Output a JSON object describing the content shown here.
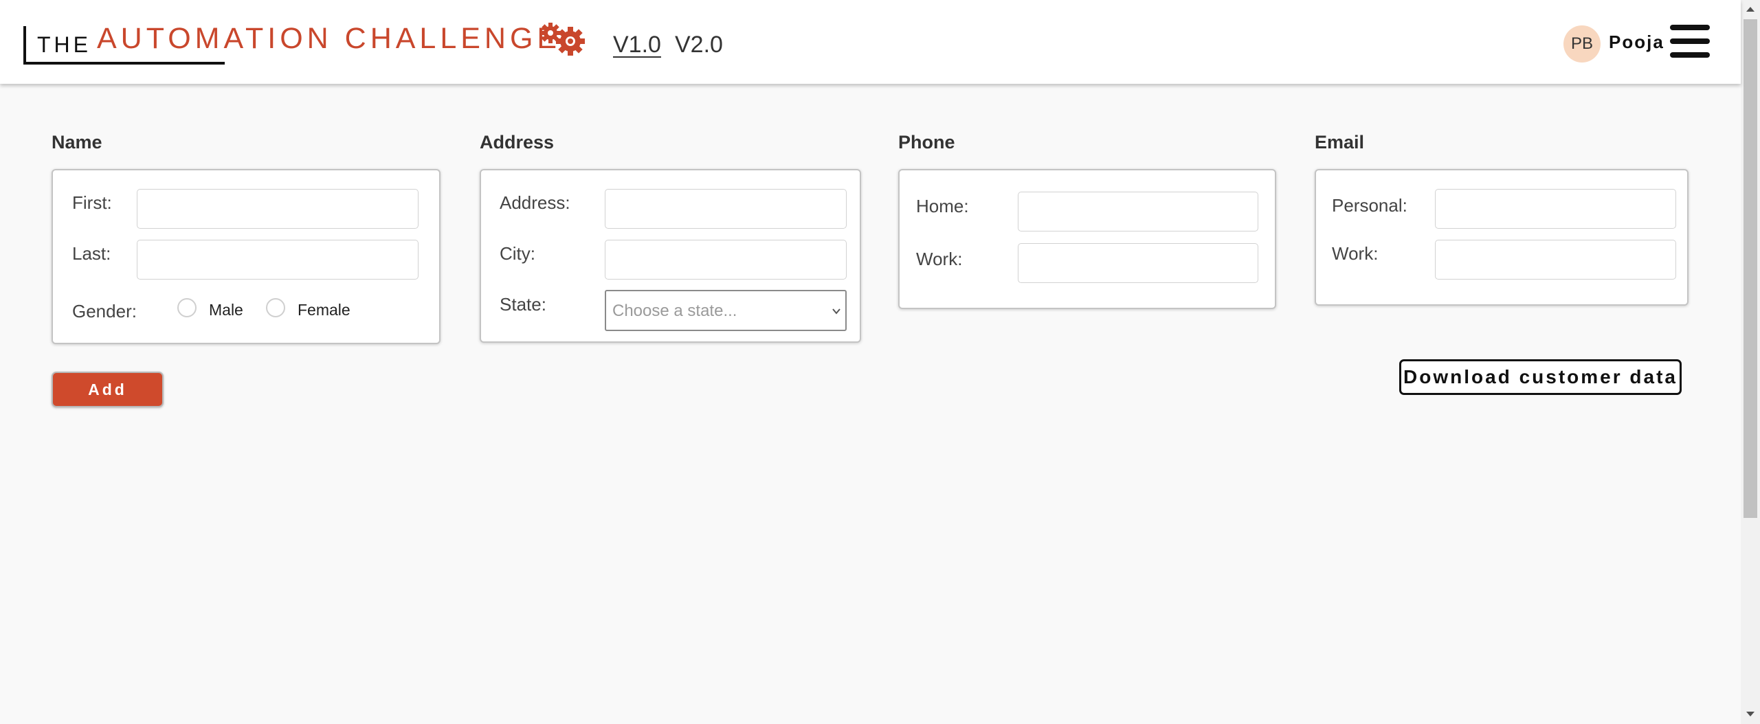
{
  "header": {
    "logo_the": "THE",
    "logo_title": "AUTOMATION CHALLENGE",
    "nav": [
      {
        "label": "V1.0"
      },
      {
        "label": "V2.0"
      }
    ],
    "avatar_initials": "PB",
    "username": "Pooja"
  },
  "colors": {
    "brand": "#c9472c",
    "button": "#cf4a2c",
    "avatar_bg": "#f8d7bf"
  },
  "icons": {
    "logo": "gears-icon",
    "menu": "hamburger-icon",
    "select": "chevron-down-icon"
  },
  "sections": {
    "name": {
      "title": "Name",
      "first_label": "First:",
      "first_value": "",
      "last_label": "Last:",
      "last_value": "",
      "gender_label": "Gender:",
      "gender_options": [
        {
          "label": "Male"
        },
        {
          "label": "Female"
        }
      ]
    },
    "address": {
      "title": "Address",
      "address_label": "Address:",
      "address_value": "",
      "city_label": "City:",
      "city_value": "",
      "state_label": "State:",
      "state_placeholder": "Choose a state..."
    },
    "phone": {
      "title": "Phone",
      "home_label": "Home:",
      "home_value": "",
      "work_label": "Work:",
      "work_value": ""
    },
    "email": {
      "title": "Email",
      "personal_label": "Personal:",
      "personal_value": "",
      "work_label": "Work:",
      "work_value": ""
    }
  },
  "actions": {
    "add_label": "Add",
    "download_label": "Download customer data"
  }
}
